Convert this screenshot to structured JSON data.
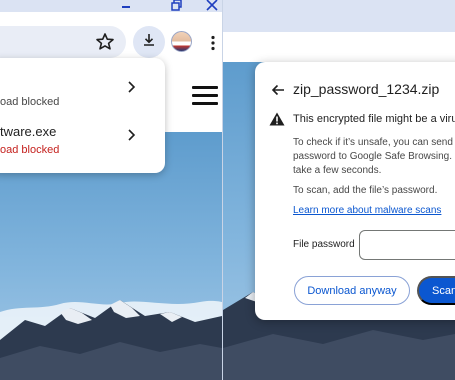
{
  "left": {
    "downloads": [
      {
        "name": "",
        "status": "oad blocked"
      },
      {
        "name": "tware.exe",
        "status": "oad blocked"
      }
    ]
  },
  "dialog": {
    "title": "zip_password_1234.zip",
    "heading": "This encrypted file might be a virus or",
    "description_lines": [
      "To check if it’s unsafe, you can send th",
      "password to Google Safe Browsing. S",
      "take a few seconds."
    ],
    "scan_prompt": "To scan, add the file’s password.",
    "learn_more": "Learn more about malware scans",
    "password_label": "File password",
    "password_value": "",
    "download_anyway": "Download anyway",
    "scan_button": "Scan"
  },
  "colors": {
    "accent": "#0b57d0",
    "blocked_text": "#c5221f",
    "chrome_frame": "#dbe3f3",
    "sky": "#6ea7d4"
  },
  "icons": {
    "toolbar": [
      "minimize-icon",
      "restore-icon",
      "close-icon",
      "star-icon",
      "download-icon",
      "profile-avatar",
      "more-vert-icon"
    ],
    "dialog": [
      "back-arrow-icon",
      "warning-icon"
    ]
  }
}
